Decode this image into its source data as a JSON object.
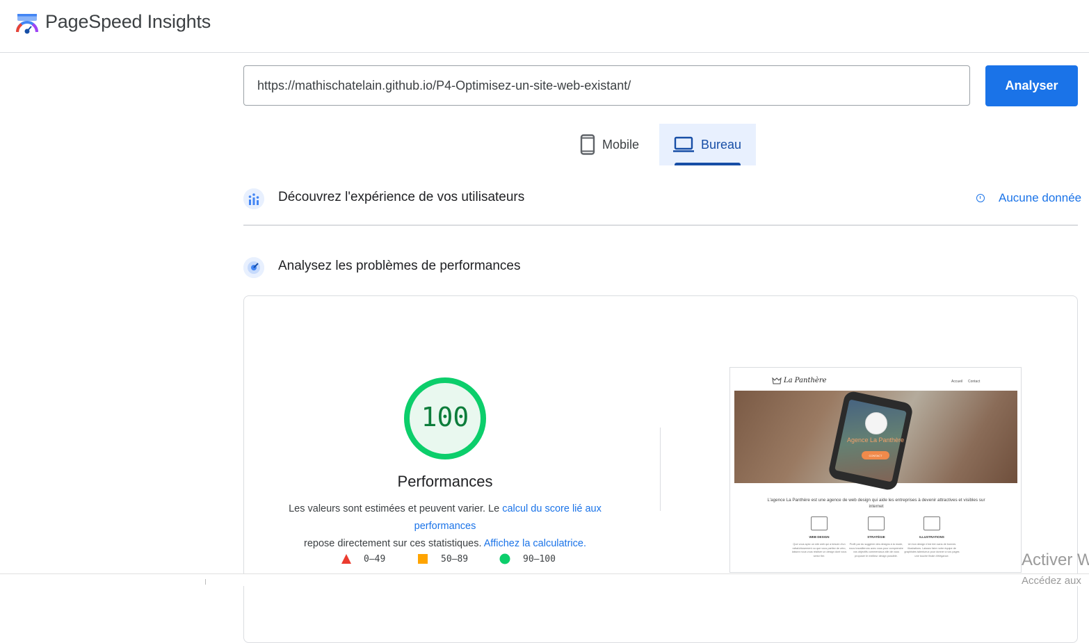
{
  "header": {
    "brand": "PageSpeed Insights"
  },
  "search": {
    "url_value": "https://mathischatelain.github.io/P4-Optimisez-un-site-web-existant/",
    "analyze_label": "Analyser"
  },
  "device_tabs": [
    {
      "label": "Mobile",
      "icon": "smartphone-icon",
      "selected": false
    },
    {
      "label": "Bureau",
      "icon": "laptop-icon",
      "selected": true
    }
  ],
  "field_data": {
    "title": "Découvrez l'expérience de vos utilisateurs",
    "status": "Aucune donnée"
  },
  "lab": {
    "title": "Analysez les problèmes de performances",
    "score": "100",
    "score_fraction": 1.0,
    "category": "Performances",
    "desc_text_1": "Les valeurs sont estimées et peuvent varier. Le ",
    "desc_link_1": "calcul du score lié aux performances",
    "desc_text_2": "repose directement sur ces statistiques. ",
    "desc_link_2": "Affichez la calculatrice.",
    "legend": [
      {
        "range": "0–49",
        "shape": "triangle",
        "color": "#eb3b2f"
      },
      {
        "range": "50–89",
        "shape": "square",
        "color": "#ffa400"
      },
      {
        "range": "90–100",
        "shape": "circle",
        "color": "#0cce6b"
      }
    ]
  },
  "screenshot_thumb": {
    "brand": "La Panthère",
    "nav": [
      "Accueil",
      "Contact"
    ],
    "hero_title": "Agence La Panthère",
    "hero_button": "CONTACT",
    "intro": "L'agence La Panthère est une agence de web design qui aide les entreprises à devenir attractives et visibles sur internet",
    "services": [
      {
        "title": "WEB DESIGN",
        "text": "Que vous ayez un site web qui a besoin d'un rafraîchissement ou que vous partiez de zéro, laissez nous vous réaliser un design dont vous serez fier."
      },
      {
        "title": "STRATÉGIE",
        "text": "Profit par du suggérer des designs à la mode, nous travaillerons avec vous pour comprendre vos objectifs commerciaux afin de vous proposer le meilleur design possible."
      },
      {
        "title": "ILLUSTRATIONS",
        "text": "Un bon design n'est rien sans de bonnes illustrations. Laissez faire notre équipe de graphistes talentueux pour donner à vos pages une touche finale d'élégance."
      }
    ]
  },
  "watermark": {
    "line1": "Activer W",
    "line2": "Accédez aux"
  },
  "colors": {
    "accent": "#1a73e8",
    "pass": "#0cce6b",
    "pass_text": "#0d7d3b"
  }
}
